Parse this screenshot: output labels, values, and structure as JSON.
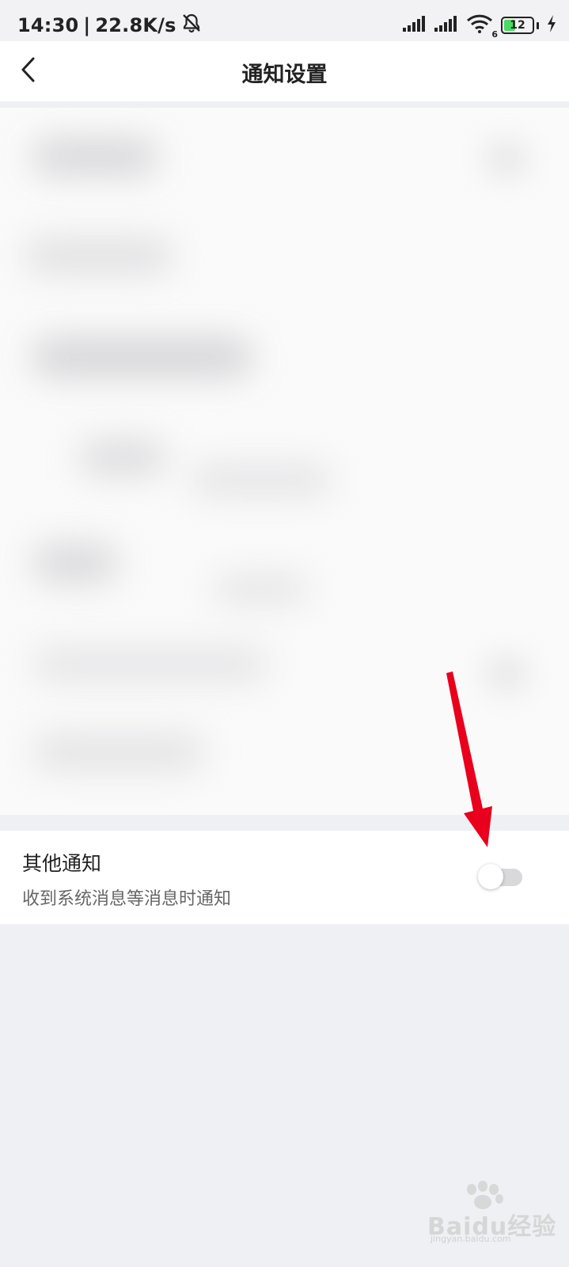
{
  "status_bar": {
    "time": "14:30",
    "net_speed": "22.8K/s",
    "battery": "12",
    "wifi_badge": "6",
    "icons": [
      "mute-bell-icon",
      "signal-icon",
      "signal-icon",
      "wifi-icon",
      "battery-icon",
      "charging-icon"
    ]
  },
  "header": {
    "title": "通知设置",
    "back_icon": "chevron-left-icon"
  },
  "setting": {
    "title": "其他通知",
    "description": "收到系统消息等消息时通知",
    "toggle_on": false
  },
  "watermark": {
    "logo_text": "Baidu经验",
    "sub_text": "jingyan.baidu.com"
  },
  "colors": {
    "page_bg": "#eef0f4",
    "card_bg": "#ffffff",
    "title": "#222222",
    "desc": "#666666",
    "toggle_off": "#d9d9dc",
    "annotation_red": "#e8001c"
  }
}
